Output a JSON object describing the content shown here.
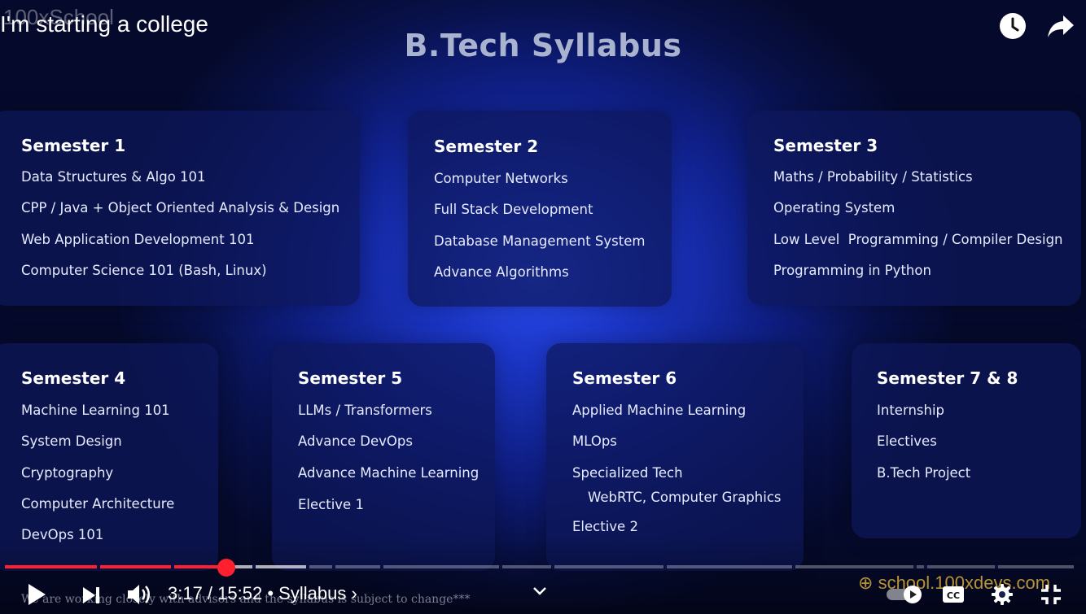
{
  "video": {
    "title": "I'm starting a college",
    "channel_overlay": "100xSchool"
  },
  "slide": {
    "title": "B.Tech Syllabus",
    "semesters": [
      {
        "name": "Semester 1",
        "subjects": [
          "Data Structures & Algo 101",
          "CPP / Java + Object Oriented Analysis & Design",
          "Web Application Development 101",
          "Computer Science 101 (Bash, Linux)"
        ]
      },
      {
        "name": "Semester 2",
        "subjects": [
          "Computer Networks",
          "Full Stack Development",
          "Database Management System",
          "Advance Algorithms"
        ]
      },
      {
        "name": "Semester 3",
        "subjects": [
          "Maths / Probability / Statistics",
          "Operating System",
          "Low Level  Programming / Compiler Design",
          "Programming in Python"
        ]
      },
      {
        "name": "Semester 4",
        "subjects": [
          "Machine Learning 101",
          "System Design",
          "Cryptography",
          "Computer Architecture",
          "DevOps 101"
        ]
      },
      {
        "name": "Semester 5",
        "subjects": [
          "LLMs / Transformers",
          "Advance DevOps",
          "Advance Machine Learning",
          "Elective 1"
        ]
      },
      {
        "name": "Semester 6",
        "subjects": [
          "Applied Machine Learning",
          "MLOps",
          "Specialized Tech",
          "WebRTC, Computer Graphics",
          "Elective 2"
        ]
      },
      {
        "name": "Semester 7 & 8",
        "subjects": [
          "Internship",
          "Electives",
          "B.Tech Project"
        ]
      }
    ],
    "disclaimer": "We are working closely with advisors and the syllabus is subject to change***",
    "watermark": "school.100xdevs.com"
  },
  "player": {
    "time": "3:17 / 15:52",
    "chapter": "Syllabus",
    "chapter_chevron": "›",
    "progress": 0.207,
    "buffered": 0.284,
    "colors": {
      "played": "#ff1f2f",
      "background": "#0f1f86"
    },
    "icons": [
      "clock-icon",
      "share-icon",
      "play-icon",
      "next-icon",
      "volume-icon",
      "chevron-down-icon",
      "autoplay-toggle",
      "cc-icon",
      "settings-icon",
      "exit-fullscreen-icon"
    ]
  }
}
